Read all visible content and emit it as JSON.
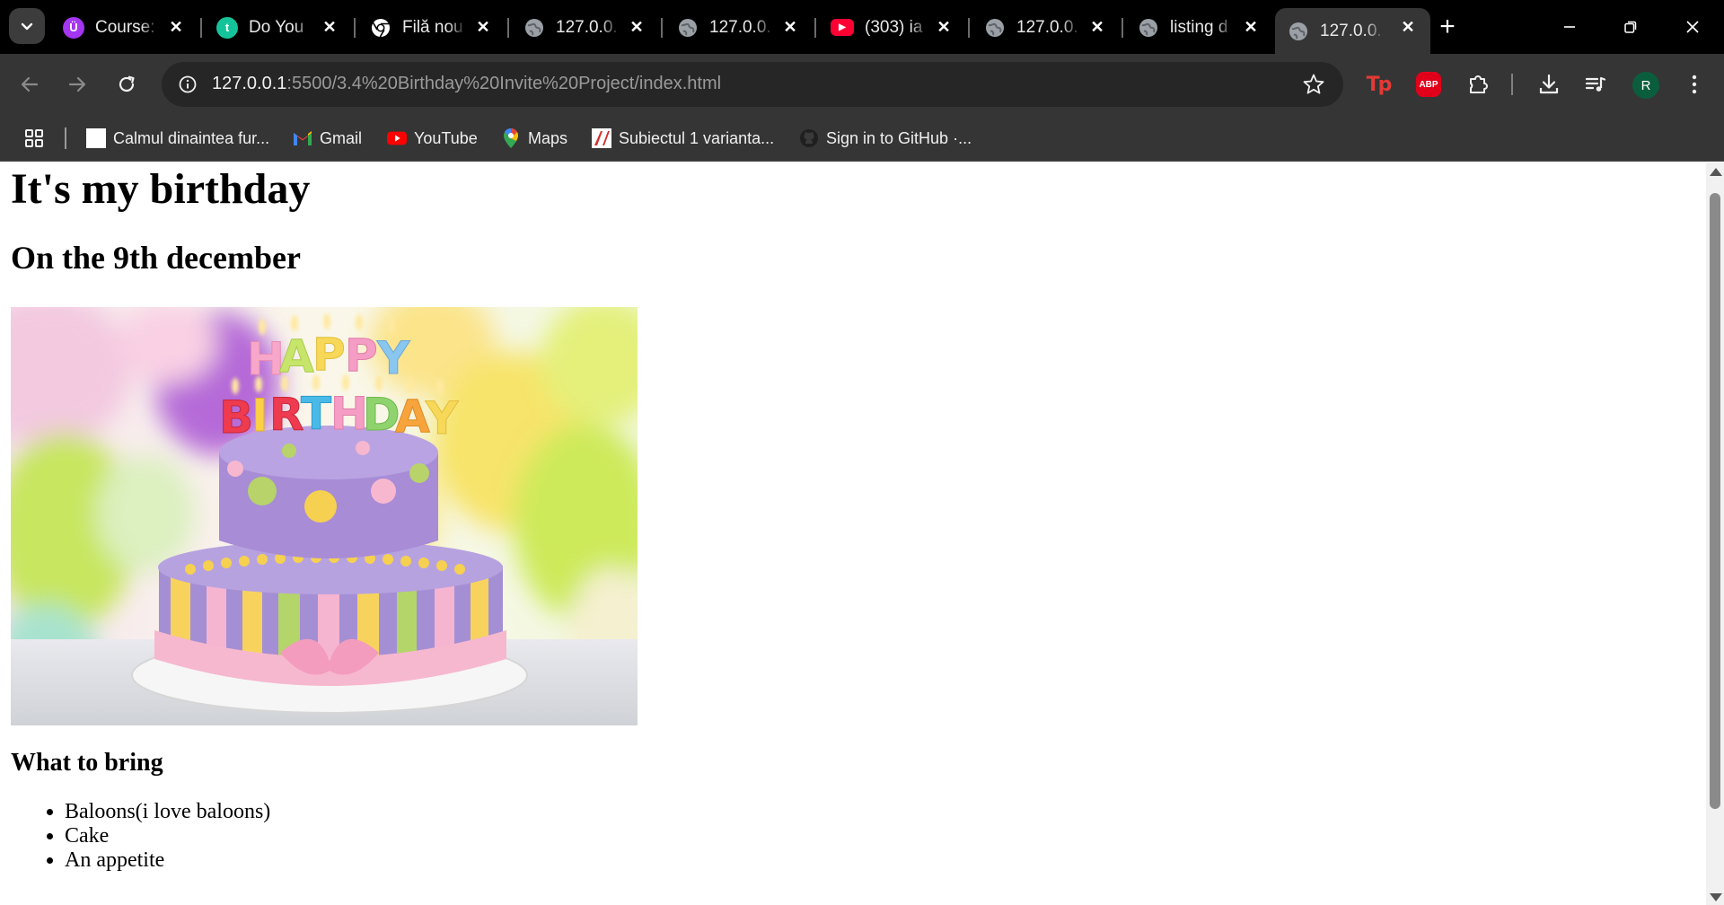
{
  "browser": {
    "tabs": [
      {
        "title": "Course:",
        "icon": "udemy-icon",
        "icon_color": "#a435f0",
        "icon_glyph": "Ü"
      },
      {
        "title": "Do You",
        "icon": "grammar-app-icon",
        "icon_color": "#15c39a",
        "icon_glyph": "t"
      },
      {
        "title": "Filă nou",
        "icon": "chrome-icon",
        "icon_color": "#ffffff",
        "icon_glyph": ""
      },
      {
        "title": "127.0.0.",
        "icon": "globe-icon",
        "icon_color": "#9aa0a6",
        "icon_glyph": ""
      },
      {
        "title": "127.0.0.",
        "icon": "globe-icon",
        "icon_color": "#9aa0a6",
        "icon_glyph": ""
      },
      {
        "title": "(303) ia",
        "icon": "youtube-icon",
        "icon_color": "#ff0033",
        "icon_glyph": "▶"
      },
      {
        "title": "127.0.0.",
        "icon": "globe-icon",
        "icon_color": "#9aa0a6",
        "icon_glyph": ""
      },
      {
        "title": "listing d",
        "icon": "globe-icon",
        "icon_color": "#9aa0a6",
        "icon_glyph": ""
      },
      {
        "title": "127.0.0.",
        "icon": "globe-icon",
        "icon_color": "#9aa0a6",
        "icon_glyph": "",
        "active": true
      }
    ],
    "address": {
      "host": "127.0.0.1",
      "path": ":5500/3.4%20Birthday%20Invite%20Project/index.html"
    },
    "extensions": {
      "tp_label": "Tp",
      "abp_label": "ABP"
    },
    "profile_initial": "R",
    "bookmarks": [
      {
        "label": "Calmul dinaintea fur...",
        "icon": "page-icon"
      },
      {
        "label": "Gmail",
        "icon": "gmail-icon"
      },
      {
        "label": "YouTube",
        "icon": "youtube-icon"
      },
      {
        "label": "Maps",
        "icon": "maps-icon"
      },
      {
        "label": "Subiectul 1 varianta...",
        "icon": "doc-icon"
      },
      {
        "label": "Sign in to GitHub ·...",
        "icon": "github-icon"
      }
    ]
  },
  "page": {
    "heading": "It's my birthday",
    "subheading": "On the 9th december",
    "image_caption_text": "HAPPY BIRTHDAY",
    "bring_heading": "What to bring",
    "bring_items": [
      "Baloons(i love baloons)",
      "Cake",
      "An appetite"
    ]
  },
  "colors": {
    "chrome_dark": "#000000",
    "toolbar": "#353535",
    "omnibox": "#262626",
    "accent_red": "#e53935"
  }
}
